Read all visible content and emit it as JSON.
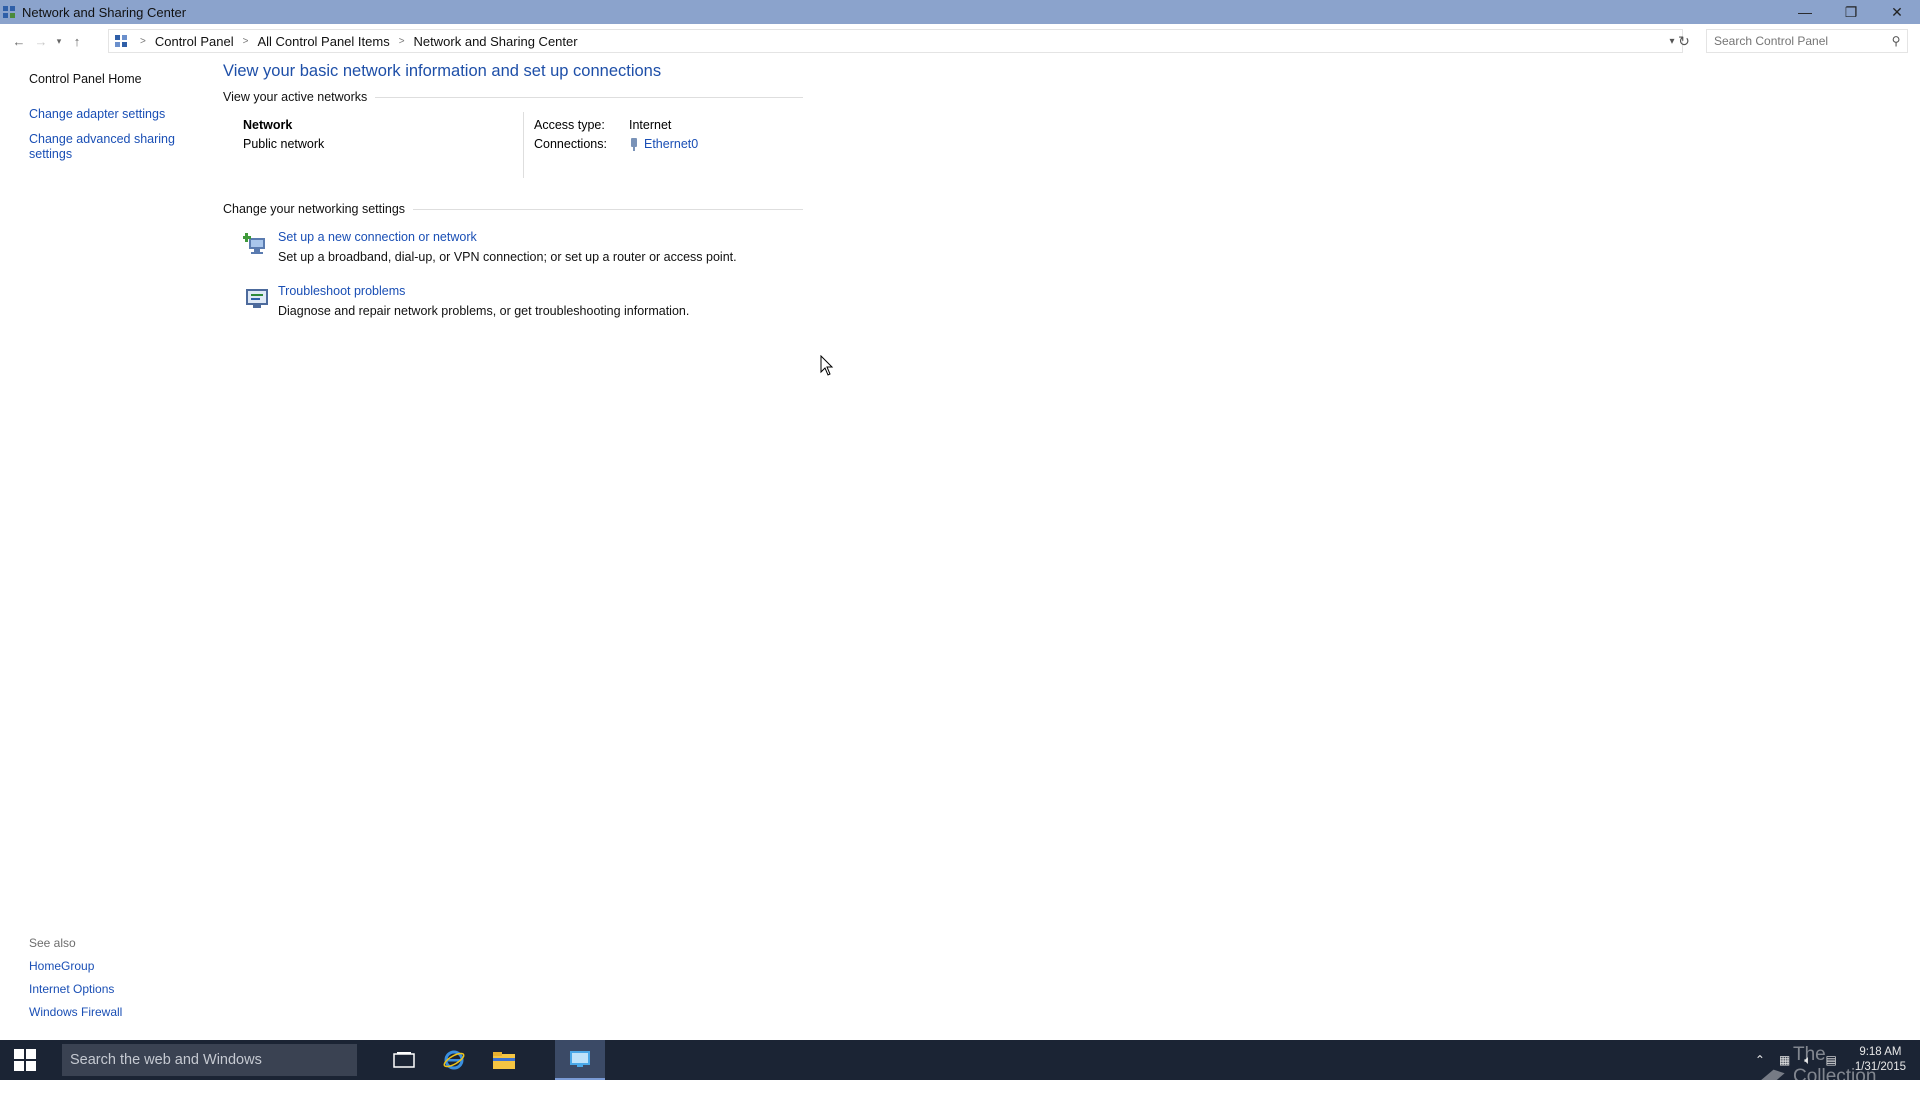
{
  "window": {
    "title": "Network and Sharing Center",
    "controls": {
      "minimize": "—",
      "restore": "❐",
      "close": "✕"
    }
  },
  "address": {
    "breadcrumbs": [
      "Control Panel",
      "All Control Panel Items",
      "Network and Sharing Center"
    ],
    "search_placeholder": "Search Control Panel"
  },
  "left_pane": {
    "home": "Control Panel Home",
    "links": [
      "Change adapter settings",
      "Change advanced sharing settings"
    ],
    "see_also_header": "See also",
    "see_also": [
      "HomeGroup",
      "Internet Options",
      "Windows Firewall"
    ]
  },
  "main": {
    "title": "View your basic network information and set up connections",
    "active_networks_header": "View your active networks",
    "network": {
      "name": "Network",
      "type": "Public network",
      "access_type_label": "Access type:",
      "access_type_value": "Internet",
      "connections_label": "Connections:",
      "connections_value": "Ethernet0"
    },
    "settings_header": "Change your networking settings",
    "tasks": [
      {
        "link": "Set up a new connection or network",
        "desc": "Set up a broadband, dial-up, or VPN connection; or set up a router or access point.",
        "icon": "new-connection-icon"
      },
      {
        "link": "Troubleshoot problems",
        "desc": "Diagnose and repair network problems, or get troubleshooting information.",
        "icon": "troubleshoot-icon"
      }
    ]
  },
  "taskbar": {
    "search_placeholder": "Search the web and Windows",
    "watermark": "The Collection Book",
    "time": "9:18 AM",
    "date": "1/31/2015"
  },
  "colors": {
    "titlebar": "#8ba3cc",
    "link": "#1a4fb5",
    "title_blue": "#1e4fa8",
    "taskbar": "#1b2434"
  }
}
